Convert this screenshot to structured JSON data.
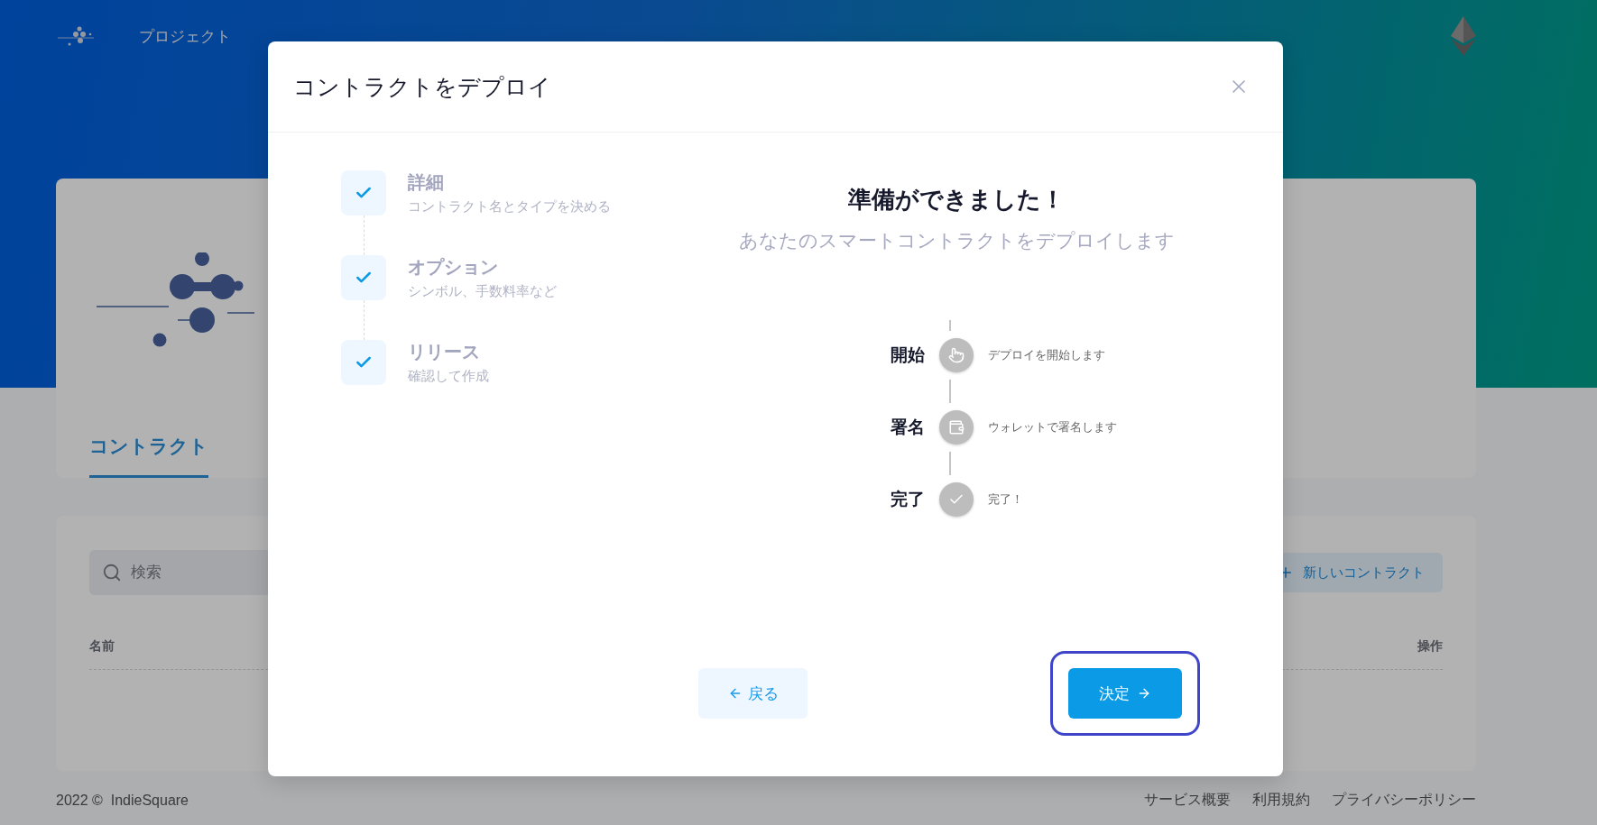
{
  "header": {
    "nav_label": "プロジェクト"
  },
  "project_card": {
    "tabs": [
      {
        "label": "コントラクト",
        "selected": true
      }
    ]
  },
  "contracts_panel": {
    "search": {
      "placeholder": "検索"
    },
    "new_button": "新しいコントラクト",
    "columns": [
      "名前",
      "操作"
    ]
  },
  "footer": {
    "copyright": "2022 ©  IndieSquare",
    "links": [
      "サービス概要",
      "利用規約",
      "プライバシーポリシー"
    ]
  },
  "modal": {
    "title": "コントラクトをデプロイ",
    "steps": [
      {
        "title": "詳細",
        "subtitle": "コントラクト名とタイプを決める",
        "checked": true
      },
      {
        "title": "オプション",
        "subtitle": "シンボル、手数料率など",
        "checked": true
      },
      {
        "title": "リリース",
        "subtitle": "確認して作成",
        "checked": true
      }
    ],
    "heading": "準備ができました！",
    "subheading": "あなたのスマートコントラクトをデプロイします",
    "timeline": [
      {
        "kind": "start",
        "label": "開始",
        "description": "デプロイを開始します"
      },
      {
        "kind": "sign",
        "label": "署名",
        "description": "ウォレットで署名します"
      },
      {
        "kind": "done",
        "label": "完了",
        "description": "完了！"
      }
    ],
    "back_button": "戻る",
    "confirm_button": "決定",
    "confirm_focused": true
  }
}
